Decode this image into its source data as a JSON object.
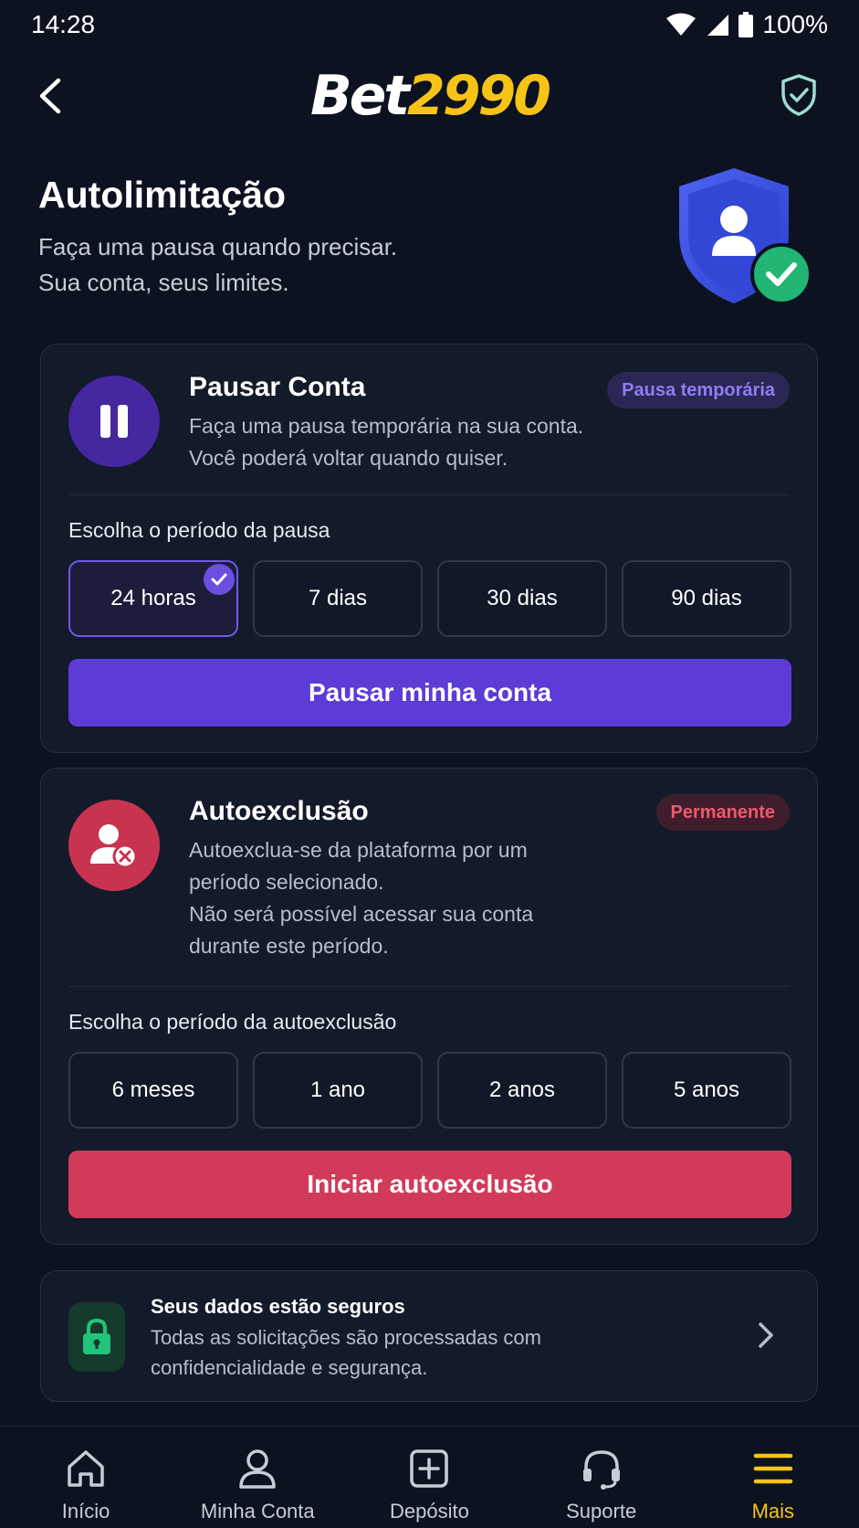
{
  "status_bar": {
    "time": "14:28",
    "battery": "100%"
  },
  "header": {
    "logo_part1": "Bet",
    "logo_part2": "2990"
  },
  "hero": {
    "title": "Autolimitação",
    "subtitle_line1": "Faça uma pausa quando precisar.",
    "subtitle_line2": "Sua conta, seus limites."
  },
  "pause_card": {
    "title": "Pausar Conta",
    "badge": "Pausa temporária",
    "desc_line1": "Faça uma pausa temporária na sua conta.",
    "desc_line2": "Você poderá voltar quando quiser.",
    "section_label": "Escolha o período da pausa",
    "options": [
      "24 horas",
      "7 dias",
      "30 dias",
      "90 dias"
    ],
    "selected_option": "24 horas",
    "cta": "Pausar minha conta"
  },
  "exclusion_card": {
    "title": "Autoexclusão",
    "badge": "Permanente",
    "desc_line1": "Autoexclua-se da plataforma por um",
    "desc_line2": "período selecionado.",
    "desc_line3": "Não será possível acessar sua conta",
    "desc_line4": "durante este período.",
    "section_label": "Escolha o período da autoexclusão",
    "options": [
      "6 meses",
      "1 ano",
      "2 anos",
      "5 anos"
    ],
    "cta": "Iniciar autoexclusão"
  },
  "security_card": {
    "title": "Seus dados estão seguros",
    "desc_line1": "Todas as solicitações são processadas com",
    "desc_line2": "confidencialidade e segurança."
  },
  "bottom_nav": {
    "items": [
      {
        "label": "Início",
        "icon": "home-icon"
      },
      {
        "label": "Minha Conta",
        "icon": "user-icon"
      },
      {
        "label": "Depósito",
        "icon": "plus-square-icon"
      },
      {
        "label": "Suporte",
        "icon": "headset-icon"
      },
      {
        "label": "Mais",
        "icon": "menu-icon"
      }
    ],
    "active": "Mais"
  },
  "colors": {
    "background": "#0c1220",
    "card": "#131a2a",
    "accent_purple": "#5c3bd7",
    "accent_red": "#d23a5a",
    "brand_yellow": "#f6c417",
    "success_green": "#22b573"
  }
}
